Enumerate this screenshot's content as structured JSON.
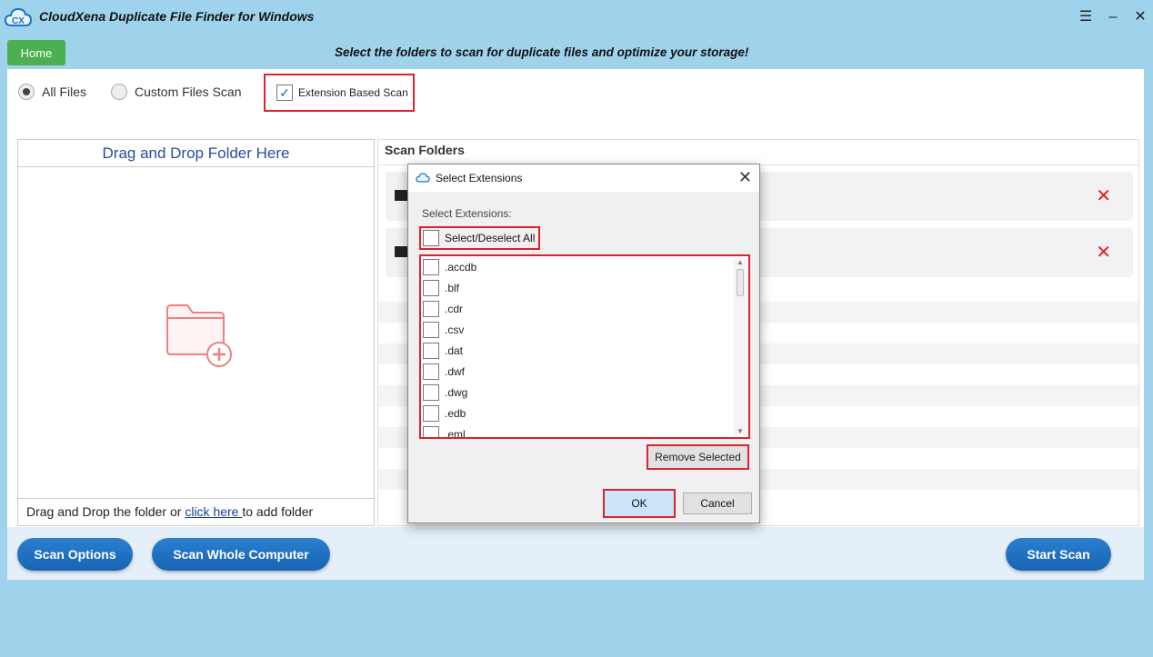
{
  "app": {
    "title": "CloudXena Duplicate File Finder for Windows",
    "menu_glyph": "☰",
    "minimize_glyph": "–",
    "close_glyph": "✕"
  },
  "header": {
    "home_label": "Home",
    "tagline": "Select the folders to scan for duplicate files and optimize your storage!"
  },
  "scan_modes": {
    "all_files": "All Files",
    "custom_files": "Custom Files Scan",
    "extension_based": "Extension Based Scan",
    "selected": "all_files",
    "extension_checked": true
  },
  "drag_panel": {
    "title": "Drag and Drop Folder Here",
    "footer_prefix": "Drag and Drop the folder or ",
    "footer_link": " click here ",
    "footer_suffix": " to add folder"
  },
  "scan_folders": {
    "title": "Scan Folders",
    "remove_glyph": "✕"
  },
  "bottom": {
    "scan_options": "Scan Options",
    "scan_whole": "Scan Whole Computer",
    "start_scan": "Start Scan"
  },
  "dialog": {
    "title": "Select Extensions",
    "label": "Select Extensions:",
    "select_all": "Select/Deselect All",
    "extensions": [
      ".accdb",
      ".blf",
      ".cdr",
      ".csv",
      ".dat",
      ".dwf",
      ".dwg",
      ".edb",
      ".eml"
    ],
    "remove_selected": "Remove Selected",
    "ok": "OK",
    "cancel": "Cancel"
  },
  "colors": {
    "accent": "#1864b4",
    "highlight": "#d9232d",
    "home": "#4caf50",
    "background": "#9fd3ec"
  }
}
